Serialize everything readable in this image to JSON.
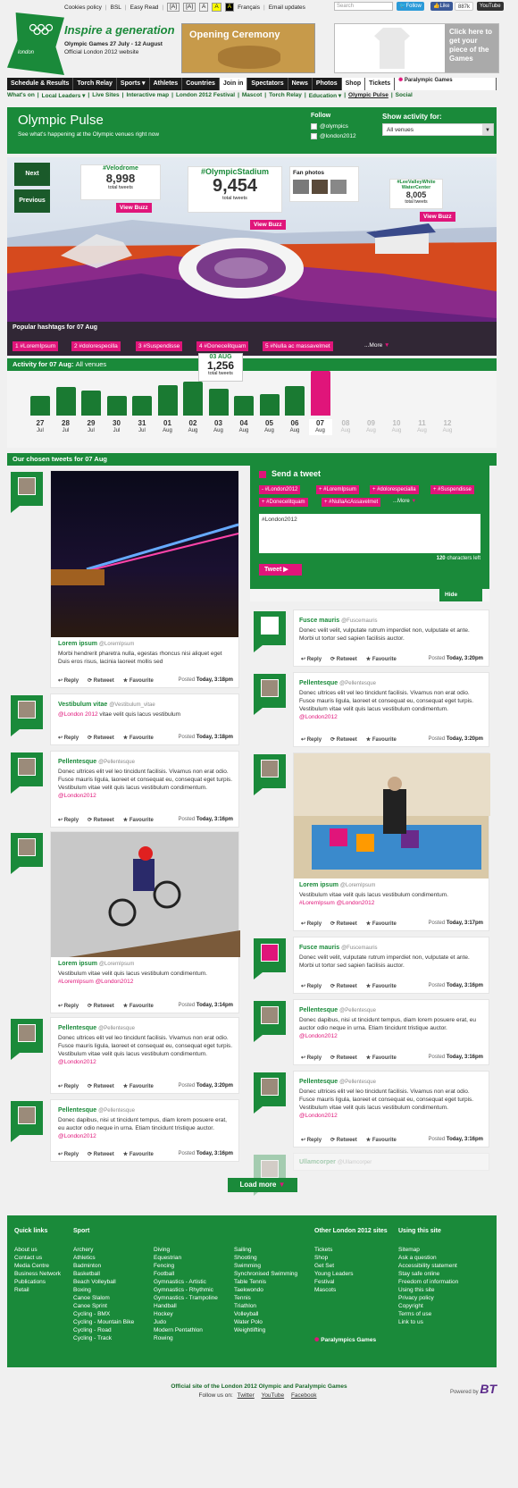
{
  "util": {
    "items": [
      "Cookies policy",
      "BSL",
      "Easy Read",
      "[A]",
      "[A]",
      "A",
      "A",
      "A",
      "Français",
      "Email updates"
    ],
    "search_placeholder": "Search",
    "follow": "Follow",
    "like": "Like",
    "like_count": "887k",
    "youtube": "YouTube"
  },
  "brand": {
    "logo_text": "london",
    "tagline": "Inspire a generation",
    "dates": "Olympic Games 27 July - 12 August",
    "official": "Official London 2012 website"
  },
  "ads": {
    "opening": "Opening Ceremony",
    "shirt": "Click here to get your piece of the Games"
  },
  "nav": [
    "Schedule & Results",
    "Torch Relay",
    "Sports ▾",
    "Athletes",
    "Countries",
    "Join in",
    "Spectators",
    "News",
    "Photos",
    "Shop",
    "Tickets",
    "Paralympic Games"
  ],
  "subnav": [
    "What's on",
    "Local Leaders ▾",
    "Live Sites",
    "Interactive map",
    "London 2012 Festival",
    "Mascot",
    "Torch Relay",
    "Education ▾",
    "Olympic Pulse",
    "Social"
  ],
  "pulse": {
    "title": "Olympic Pulse",
    "subtitle": "See what's happening at the Olympic venues right now",
    "follow_label": "Follow",
    "follow_items": [
      "@olympics",
      "@london2012"
    ],
    "show_label": "Show activity for:",
    "venue_value": "All venues"
  },
  "scene": {
    "next": "Next",
    "prev": "Previous",
    "velodrome": {
      "tag": "#Velodrome",
      "count": "8,998",
      "label": "total tweets",
      "buzz": "View Buzz"
    },
    "stadium": {
      "tag": "#OlympicStadium",
      "count": "9,454",
      "label": "total tweets",
      "buzz": "View Buzz"
    },
    "fanphotos": "Fan photos",
    "lee": {
      "tag": "#LeeValleyWhite WaterCenter",
      "count": "8,005",
      "label": "total tweets",
      "buzz": "View Buzz"
    },
    "popular_title": "Popular hashtags for 07 Aug",
    "hashtags": [
      "1 #LoremIpsum",
      "2 #dolorespecilla",
      "3 #Suspendisse",
      "4 #Donecelitquam",
      "5 #Nulla ac massavelmet"
    ],
    "more": "...More"
  },
  "activity": {
    "title": "Activity for 07 Aug:",
    "venue": "All venues",
    "callout_date": "03 AUG",
    "callout_count": "1,256",
    "callout_label": "total tweets",
    "days": [
      {
        "d": "27",
        "m": "Jul",
        "v": 22
      },
      {
        "d": "28",
        "m": "Jul",
        "v": 32
      },
      {
        "d": "29",
        "m": "Jul",
        "v": 28
      },
      {
        "d": "30",
        "m": "Jul",
        "v": 22
      },
      {
        "d": "31",
        "m": "Jul",
        "v": 22
      },
      {
        "d": "01",
        "m": "Aug",
        "v": 34
      },
      {
        "d": "02",
        "m": "Aug",
        "v": 38
      },
      {
        "d": "03",
        "m": "Aug",
        "v": 30
      },
      {
        "d": "04",
        "m": "Aug",
        "v": 22
      },
      {
        "d": "05",
        "m": "Aug",
        "v": 24
      },
      {
        "d": "06",
        "m": "Aug",
        "v": 33
      },
      {
        "d": "07",
        "m": "Aug",
        "v": 50
      },
      {
        "d": "08",
        "m": "Aug",
        "v": 0
      },
      {
        "d": "09",
        "m": "Aug",
        "v": 0
      },
      {
        "d": "10",
        "m": "Aug",
        "v": 0
      },
      {
        "d": "11",
        "m": "Aug",
        "v": 0
      },
      {
        "d": "12",
        "m": "Aug",
        "v": 0
      }
    ]
  },
  "chosen_title": "Our chosen tweets for 07 Aug",
  "send": {
    "title": "Send a tweet",
    "tags": [
      "- #London2012",
      "+ #LoremIpsum",
      "+ #dolorespecialla",
      "+ #Suspendisse",
      "+ #Donecelitquam",
      "+ #NullaAcAssavelmet"
    ],
    "more": "...More",
    "text": "#London2012",
    "chars": "120",
    "chars_label": "characters left",
    "button": "Tweet",
    "hide": "Hide"
  },
  "actions": {
    "reply": "Reply",
    "retweet": "Retweet",
    "favourite": "Favourite",
    "posted": "Posted"
  },
  "tweets_left": [
    {
      "name": "Lorem ipsum",
      "handle": "@LoremIpsum",
      "body": "Morbi hendrerit pharetra nulla, egestas rhoncus nisi aliquet eget Duis eros risus, lacinia laoreet mollis sed",
      "time": "Today, 3:18pm"
    },
    {
      "name": "Vestibulum vitae",
      "handle": "@Vestibulum_vitae",
      "mention": "@London 2012",
      "body": " vitae velit quis lacus vestibulum",
      "time": "Today, 3:18pm"
    },
    {
      "name": "Pellentesque",
      "handle": "@Pellentesque",
      "body": "Donec ultrices elit vel leo tincidunt facilisis. Vivamus non erat odio. Fusce mauris ligula, laoreet et consequat eu, consequat eget turpis. Vestibulum vitae velit quis lacus vestibulum condimentum.",
      "mention": "@London2012",
      "time": "Today, 3:16pm"
    },
    {
      "name": "Lorem ipsum",
      "handle": "@LoremIpsum",
      "body": "Vestibulum vitae velit quis lacus vestibulum condimentum.",
      "tag": "#LoremIpsum",
      "mention": "@London2012",
      "time": "Today, 3:14pm"
    },
    {
      "name": "Pellentesque",
      "handle": "@Pellentesque",
      "body": "Donec ultrices elit vel leo tincidunt facilisis. Vivamus non erat odio. Fusce mauris ligula, laoreet et consequat eu, consequat eget turpis. Vestibulum vitae velit quis lacus vestibulum condimentum.",
      "mention": "@London2012",
      "time": "Today, 3:20pm"
    },
    {
      "name": "Pellentesque",
      "handle": "@Pellentesque",
      "body": "Donec dapibus, nisi ut tincidunt tempus, diam lorem posuere erat, eu auctor odio neque in urna. Etiam tincidunt tristique auctor.",
      "mention": "@London2012",
      "time": "Today, 3:16pm"
    }
  ],
  "tweets_right": [
    {
      "name": "Fusce mauris",
      "handle": "@Fuscemauris",
      "body": "Donec velit velit, vulputate rutrum imperdiet non, vulputate et ante. Morbi ut tortor sed sapien facilisis auctor.",
      "time": "Today, 3:20pm"
    },
    {
      "name": "Pellentesque",
      "handle": "@Pellentesque",
      "body": "Donec ultrices elit vel leo tincidunt facilisis. Vivamus non erat odio. Fusce mauris ligula, laoreet et consequat eu, consequat eget turpis. Vestibulum vitae velit quis lacus vestibulum condimentum.",
      "mention": "@London2012",
      "time": "Today, 3:20pm"
    },
    {
      "name": "Lorem ipsum",
      "handle": "@LoremIpsum",
      "body": "Vestibulum vitae velit quis lacus vestibulum condimentum.",
      "tag": "#LoremIpsum",
      "mention": "@London2012",
      "time": "Today, 3:17pm"
    },
    {
      "name": "Fusce mauris",
      "handle": "@Fuscemauris",
      "body": "Donec velit velit, vulputate rutrum imperdiet non, vulputate et ante. Morbi ut tortor sed sapien facilisis auctor.",
      "time": "Today, 3:16pm"
    },
    {
      "name": "Pellentesque",
      "handle": "@Pellentesque",
      "body": "Donec dapibus, nisi ut tincidunt tempus, diam lorem posuere erat, eu auctor odio neque in urna. Etiam tincidunt tristique auctor.",
      "mention": "@London2012",
      "time": "Today, 3:16pm"
    },
    {
      "name": "Pellentesque",
      "handle": "@Pellentesque",
      "body": "Donec ultrices elit vel leo tincidunt facilisis. Vivamus non erat odio. Fusce mauris ligula, laoreet et consequat eu, consequat eget turpis. Vestibulum vitae velit quis lacus vestibulum condimentum.",
      "mention": "@London2012",
      "time": "Today, 3:16pm"
    },
    {
      "name": "Ullamcorper",
      "handle": "@Ullamcorper"
    }
  ],
  "loadmore": "Load more",
  "footer": {
    "quick_title": "Quick links",
    "quick": [
      "About us",
      "Contact us",
      "Media Centre",
      "Business Network",
      "Publications",
      "Retail"
    ],
    "sport_title": "Sport",
    "sport1": [
      "Archery",
      "Athletics",
      "Badminton",
      "Basketball",
      "Beach Volleyball",
      "Boxing",
      "Canoe Slalom",
      "Canoe Sprint",
      "Cycling - BMX",
      "Cycling - Mountain Bike",
      "Cycling - Road",
      "Cycling - Track"
    ],
    "sport2": [
      "Diving",
      "Equestrian",
      "Fencing",
      "Football",
      "Gymnastics - Artistic",
      "Gymnastics - Rhythmic",
      "Gymnastics - Trampoline",
      "Handball",
      "Hockey",
      "Judo",
      "Modern Pentathlon",
      "Rowing"
    ],
    "sport3": [
      "Sailing",
      "Shooting",
      "Swimming",
      "Synchronised Swimming",
      "Table Tennis",
      "Taekwondo",
      "Tennis",
      "Triathlon",
      "Volleyball",
      "Water Polo",
      "Weightlifting"
    ],
    "other_title": "Other London 2012  sites",
    "other": [
      "Tickets",
      "Shop",
      "Get Set",
      "Young Leaders",
      "Festival",
      "Mascots"
    ],
    "using_title": "Using this site",
    "using": [
      "Sitemap",
      "Ask a question",
      "Accessibility statement",
      "Stay safe online",
      "Freedom of information",
      "Using this site",
      "Privacy policy",
      "Copyright",
      "Terms of use",
      "Link to us"
    ],
    "paralympics": "Paralympics Games"
  },
  "bottom": {
    "official": "Official site of the London 2012 Olympic and Paralympic Games",
    "follow": "Follow us on:",
    "links": [
      "Twitter",
      "YouTube",
      "Facebook"
    ],
    "powered": "Powered by",
    "bt": "BT"
  },
  "colors": {
    "green": "#1a8a3a",
    "pink": "#e0157a",
    "dark": "#1b1b1b"
  }
}
